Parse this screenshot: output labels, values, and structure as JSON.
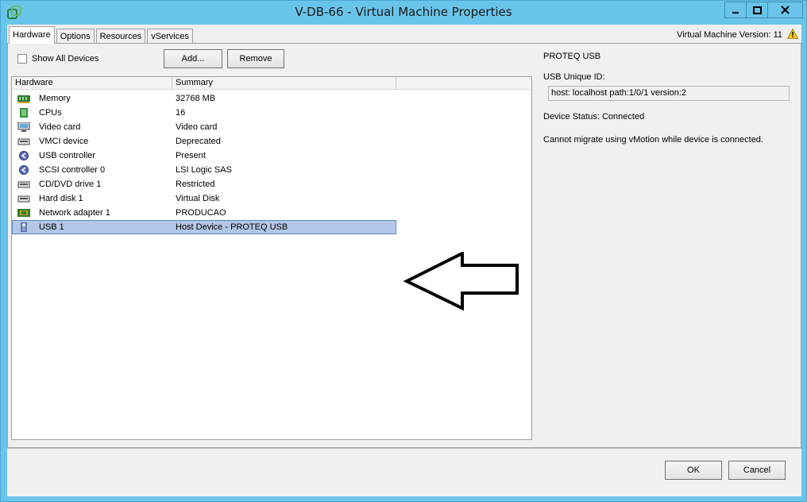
{
  "window": {
    "title": "V-DB-66 - Virtual Machine Properties",
    "controls": [
      "minimize",
      "maximize",
      "close"
    ]
  },
  "tabs": [
    {
      "label": "Hardware",
      "active": true
    },
    {
      "label": "Options",
      "active": false
    },
    {
      "label": "Resources",
      "active": false
    },
    {
      "label": "vServices",
      "active": false
    }
  ],
  "vm_version": "Virtual Machine Version: 11",
  "toolbar": {
    "show_all_devices": "Show All Devices",
    "show_all_checked": false,
    "add_label": "Add...",
    "remove_label": "Remove"
  },
  "table": {
    "columns": [
      "Hardware",
      "Summary",
      ""
    ],
    "rows": [
      {
        "icon": "memory-icon",
        "name": "Memory",
        "summary": "32768 MB"
      },
      {
        "icon": "cpu-icon",
        "name": "CPUs",
        "summary": "16"
      },
      {
        "icon": "monitor-icon",
        "name": "Video card",
        "summary": "Video card"
      },
      {
        "icon": "vmci-device-icon",
        "name": "VMCI device",
        "summary": "Deprecated"
      },
      {
        "icon": "usb-controller-icon",
        "name": "USB controller",
        "summary": "Present"
      },
      {
        "icon": "scsi-controller-icon",
        "name": "SCSI controller 0",
        "summary": "LSI Logic SAS"
      },
      {
        "icon": "cd-dvd-icon",
        "name": "CD/DVD drive 1",
        "summary": "Restricted"
      },
      {
        "icon": "hard-disk-icon",
        "name": "Hard disk 1",
        "summary": "Virtual Disk"
      },
      {
        "icon": "network-adapter-icon",
        "name": "Network adapter 1",
        "summary": "PRODUCAO"
      },
      {
        "icon": "usb-device-icon",
        "name": "USB 1",
        "summary": "Host Device - PROTEQ USB",
        "selected": true
      }
    ]
  },
  "details": {
    "title": "PROTEQ USB",
    "uid_label": "USB Unique ID:",
    "uid_value": "host: localhost path:1/0/1 version:2",
    "device_status": "Device Status: Connected",
    "migrate_note": "Cannot migrate using vMotion while device is connected."
  },
  "footer": {
    "ok_label": "OK",
    "cancel_label": "Cancel"
  },
  "colors": {
    "titlebar": "#69c4ea",
    "selection": "#b3c7e6",
    "panel": "#f0f0f0"
  }
}
